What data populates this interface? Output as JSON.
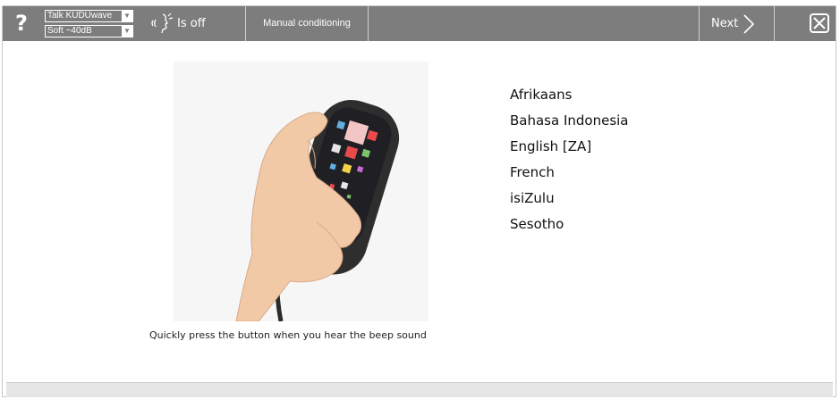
{
  "toolbar": {
    "help_label": "?",
    "voice_select": "Talk KUDUwave",
    "level_select": "Soft ~40dB",
    "sound_status": "Is off",
    "tab_label": "Manual conditioning",
    "next_label": "Next"
  },
  "main": {
    "caption": "Quickly press the button when you hear the beep sound",
    "languages": [
      "Afrikaans",
      "Bahasa Indonesia",
      "English [ZA]",
      "French",
      "isiZulu",
      "Sesotho"
    ]
  },
  "colors": {
    "toolbar_bg": "#7d7d7d",
    "toolbar_text": "#ffffff",
    "page_bg": "#ffffff"
  },
  "icons": {
    "help": "question-mark-icon",
    "sound": "speaking-head-icon",
    "next": "chevron-right-icon",
    "close": "close-x-icon"
  }
}
